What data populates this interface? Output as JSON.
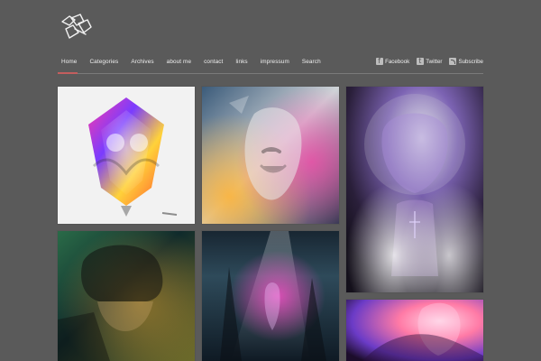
{
  "header": {
    "logo_icon": "stylized-signature-logo-icon",
    "nav": {
      "items": [
        "Home",
        "Categories",
        "Archives",
        "about me",
        "contact",
        "links",
        "impressum",
        "Search"
      ],
      "active_index": 0,
      "active_color": "#c35e5e"
    },
    "social": {
      "items": [
        {
          "label": "Facebook",
          "icon": "facebook-icon"
        },
        {
          "label": "Twitter",
          "icon": "twitter-icon"
        },
        {
          "label": "Subscribe",
          "icon": "rss-icon"
        }
      ]
    }
  },
  "gallery": {
    "tiles": [
      {
        "name": "artwork-tile-1"
      },
      {
        "name": "artwork-tile-2"
      },
      {
        "name": "artwork-tile-3"
      },
      {
        "name": "artwork-tile-4"
      },
      {
        "name": "artwork-tile-5"
      },
      {
        "name": "artwork-tile-6"
      }
    ]
  }
}
